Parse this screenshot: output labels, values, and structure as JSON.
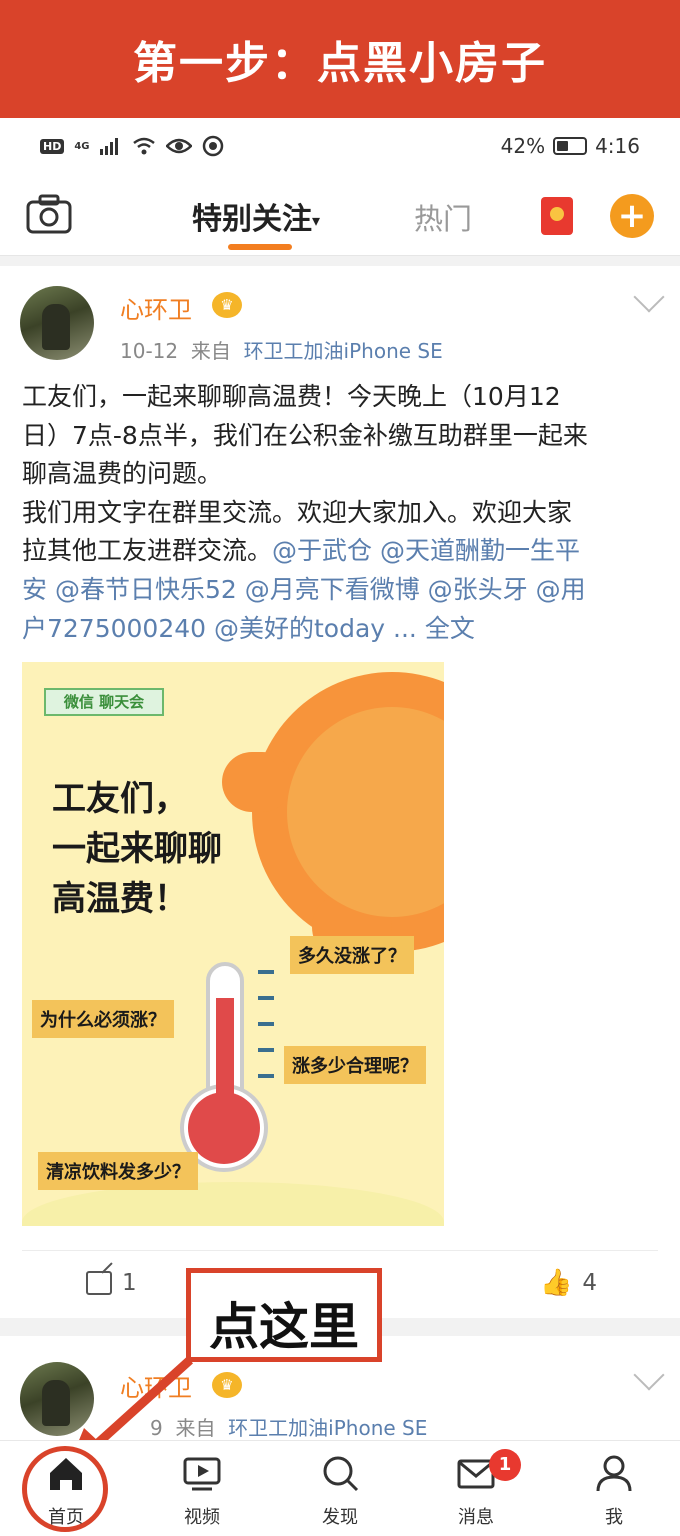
{
  "banner": {
    "title": "第一步：点黑小房子"
  },
  "statusbar": {
    "left_badge": "HD",
    "net": "4G",
    "battery": "42%",
    "time": "4:16",
    "battery_level": 0.42
  },
  "nav": {
    "tab_active": "特别关注",
    "tab_hot": "热门",
    "plus": "+"
  },
  "post1": {
    "username": "心环卫",
    "vip": "♛",
    "date": "10-12",
    "from_label": "来自",
    "source": "环卫工加油iPhone SE",
    "text_line1": "工友们，一起来聊聊高温费！今天晚上（10月12",
    "text_line2": "日）7点-8点半，我们在公积金补缴互助群里一起来",
    "text_line3": "聊高温费的问题。",
    "text_line4": "我们用文字在群里交流。欢迎大家加入。欢迎大家",
    "text_line5_plain": "拉其他工友进群交流。",
    "text_line5_mention": "@于武仓 @天道酬勤一生平",
    "text_line6": "安 @春节日快乐52 @月亮下看微博 @张头牙 @用",
    "text_line7": "户7275000240 @美好的today ... 全文"
  },
  "poster": {
    "logo": "微信 聊天会",
    "title_line1": "工友们，",
    "title_line2": "一起来聊聊",
    "title_line3": "高温费！",
    "bubble1": "多久没涨了？",
    "bubble2": "为什么必须涨？",
    "bubble3": "涨多少合理呢？",
    "bubble4": "清凉饮料发多少？"
  },
  "actions": {
    "repost_count": "1",
    "like_count": "4",
    "like_icon": "👍"
  },
  "callout": {
    "text": "点这里"
  },
  "post2": {
    "username": "心环卫",
    "vip": "♛",
    "date_partial": "9",
    "from_label": "来自",
    "source": "环卫工加油iPhone SE"
  },
  "bottom_nav": {
    "home": "首页",
    "video": "视频",
    "discover": "发现",
    "messages": "消息",
    "messages_badge": "1",
    "me": "我"
  }
}
